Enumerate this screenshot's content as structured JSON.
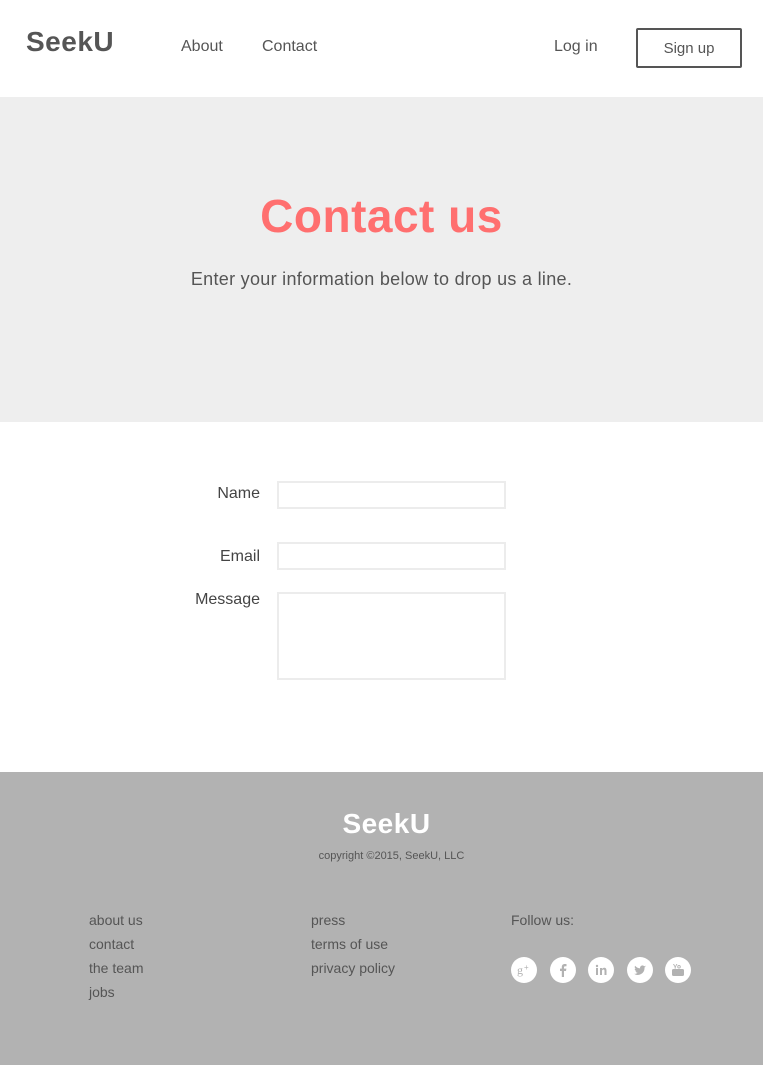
{
  "header": {
    "logo": "SeekU",
    "nav": {
      "about": "About",
      "contact": "Contact"
    },
    "login": "Log in",
    "signup": "Sign up"
  },
  "hero": {
    "title": "Contact us",
    "subtitle": "Enter your information below to drop us a line."
  },
  "form": {
    "name_label": "Name",
    "email_label": "Email",
    "message_label": "Message",
    "name_value": "",
    "email_value": "",
    "message_value": ""
  },
  "footer": {
    "logo": "SeekU",
    "copyright": "copyright ©2015, SeekU, LLC",
    "col1": [
      "about us",
      "contact",
      "the team",
      "jobs"
    ],
    "col2": [
      "press",
      "terms of use",
      "privacy policy"
    ],
    "follow_label": "Follow us:",
    "social_icons": [
      "google-plus-icon",
      "facebook-icon",
      "linkedin-icon",
      "twitter-icon",
      "youtube-icon"
    ]
  },
  "colors": {
    "accent": "#ff6f6f",
    "hero_bg": "#eeeeee",
    "footer_bg": "#b2b2b2",
    "text": "#555555"
  }
}
